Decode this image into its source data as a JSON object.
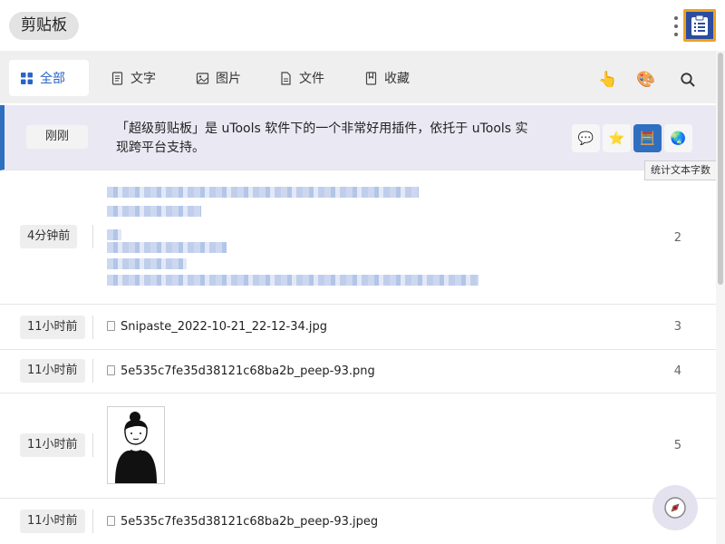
{
  "app": {
    "title": "剪贴板"
  },
  "tabs": [
    {
      "label": "全部",
      "icon": "grid-icon",
      "active": true
    },
    {
      "label": "文字",
      "icon": "text-doc-icon"
    },
    {
      "label": "图片",
      "icon": "image-icon"
    },
    {
      "label": "文件",
      "icon": "file-icon"
    },
    {
      "label": "收藏",
      "icon": "bookmark-icon"
    }
  ],
  "tools": [
    {
      "icon": "pointing-hand-icon",
      "glyph": "👆"
    },
    {
      "icon": "palette-icon",
      "glyph": "🎨"
    },
    {
      "icon": "search-icon",
      "glyph": "🔍"
    }
  ],
  "items": [
    {
      "time": "刚刚",
      "text_line1": "「超级剪贴板」是 uTools 软件下的一个非常好用插件，依托于 uTools 实",
      "text_line2": "现跨平台支持。",
      "selected": true
    },
    {
      "time": "4分钟前",
      "type": "text-blurred",
      "index": "2"
    },
    {
      "time": "11小时前",
      "type": "file",
      "filename": "Snipaste_2022-10-21_22-12-34.jpg",
      "index": "3"
    },
    {
      "time": "11小时前",
      "type": "file",
      "filename": "5e535c7fe35d38121c68ba2b_peep-93.png",
      "index": "4"
    },
    {
      "time": "11小时前",
      "type": "image",
      "index": "5"
    },
    {
      "time": "11小时前",
      "type": "file",
      "filename": "5e535c7fe35d38121c68ba2b_peep-93.jpeg"
    }
  ],
  "actions": [
    {
      "icon": "speech-bubble-icon",
      "glyph": "💬"
    },
    {
      "icon": "star-icon",
      "glyph": "⭐"
    },
    {
      "icon": "abacus-icon",
      "glyph": "🧮"
    },
    {
      "icon": "globe-icon",
      "glyph": "🌏"
    }
  ],
  "tooltip": "统计文本字数",
  "colors": {
    "accent": "#2a63c7",
    "selected_row": "#eae8f3",
    "selection_bar": "#2f6fbf"
  }
}
